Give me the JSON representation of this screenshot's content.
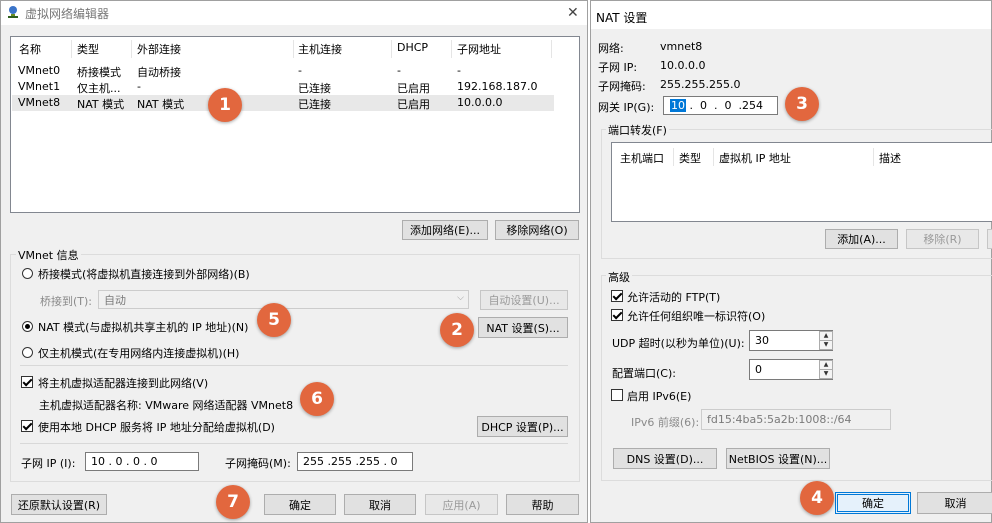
{
  "main_window": {
    "title": "虚拟网络编辑器",
    "columns": [
      "名称",
      "类型",
      "外部连接",
      "主机连接",
      "DHCP",
      "子网地址"
    ],
    "rows": [
      {
        "name": "VMnet0",
        "type": "桥接模式",
        "external": "自动桥接",
        "host": "-",
        "dhcp": "-",
        "subnet": "-"
      },
      {
        "name": "VMnet1",
        "type": "仅主机...",
        "external": "-",
        "host": "已连接",
        "dhcp": "已启用",
        "subnet": "192.168.187.0"
      },
      {
        "name": "VMnet8",
        "type": "NAT 模式",
        "external": "NAT 模式",
        "host": "已连接",
        "dhcp": "已启用",
        "subnet": "10.0.0.0"
      }
    ],
    "add_network": "添加网络(E)...",
    "remove_network": "移除网络(O)",
    "vmnet_info": "VMnet 信息",
    "bridge_mode": "桥接模式(将虚拟机直接连接到外部网络)(B)",
    "bridge_to_label": "桥接到(T):",
    "bridge_to_value": "自动",
    "auto_settings": "自动设置(U)...",
    "nat_mode": "NAT 模式(与虚拟机共享主机的 IP 地址)(N)",
    "nat_settings": "NAT 设置(S)...",
    "host_only_mode": "仅主机模式(在专用网络内连接虚拟机)(H)",
    "connect_adapter": "将主机虚拟适配器连接到此网络(V)",
    "adapter_name": "主机虚拟适配器名称: VMware 网络适配器 VMnet8",
    "use_dhcp": "使用本地 DHCP 服务将 IP 地址分配给虚拟机(D)",
    "dhcp_settings": "DHCP 设置(P)...",
    "subnet_ip_label": "子网 IP (I):",
    "subnet_ip_value": "10 . 0 . 0 . 0",
    "subnet_mask_label": "子网掩码(M):",
    "subnet_mask_value": "255 .255 .255 . 0",
    "restore_defaults": "还原默认设置(R)",
    "ok": "确定",
    "cancel": "取消",
    "apply": "应用(A)",
    "help": "帮助"
  },
  "nat_window": {
    "title": "NAT 设置",
    "network_label": "网络:",
    "network_value": "vmnet8",
    "subnet_ip_label": "子网 IP:",
    "subnet_ip_value": "10.0.0.0",
    "subnet_mask_label": "子网掩码:",
    "subnet_mask_value": "255.255.255.0",
    "gateway_label": "网关 IP(G):",
    "gateway_first": "10",
    "gateway_rest": " .  0  .  0  .254",
    "port_forwarding": "端口转发(F)",
    "pf_columns": [
      "主机端口",
      "类型",
      "虚拟机 IP 地址",
      "描述"
    ],
    "add": "添加(A)...",
    "remove": "移除(R)",
    "advanced": "高级",
    "allow_ftp": "允许活动的 FTP(T)",
    "allow_any_oui": "允许任何组织唯一标识符(O)",
    "udp_timeout_label": "UDP 超时(以秒为单位)(U):",
    "udp_timeout_value": "30",
    "config_port_label": "配置端口(C):",
    "config_port_value": "0",
    "enable_ipv6": "启用 IPv6(E)",
    "ipv6_prefix_label": "IPv6 前缀(6):",
    "ipv6_prefix_value": "fd15:4ba5:5a2b:1008::/64",
    "dns_settings": "DNS 设置(D)...",
    "netbios_settings": "NetBIOS 设置(N)...",
    "ok": "确定",
    "cancel": "取消"
  },
  "markers": [
    "1",
    "2",
    "3",
    "4",
    "5",
    "6",
    "7"
  ],
  "colors": {
    "marker": "#e2673e",
    "focus": "#0078d7",
    "selected_row": "#e8e8e8"
  }
}
